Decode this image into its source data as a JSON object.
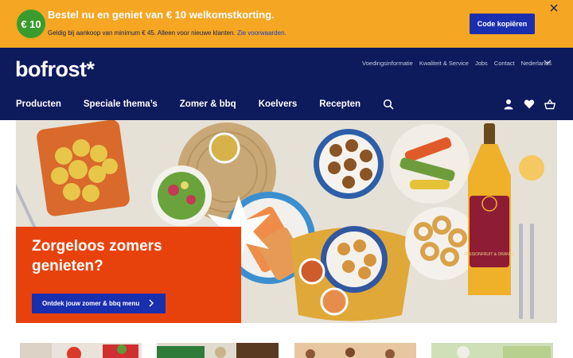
{
  "promo": {
    "badge": "€ 10",
    "title": "Bestel nu en geniet van € 10 welkomstkorting.",
    "subtitle": "Geldig bij aankoop van minimum € 45. Alleen voor nieuwe klanten.",
    "link": "Zie voorwaarden.",
    "button": "Code kopiëren"
  },
  "header": {
    "logo": "bofrost*",
    "topnav": [
      "Voedingsinformatie",
      "Kwaliteit & Service",
      "Jobs",
      "Contact",
      "Nederlands"
    ],
    "mainnav": [
      "Producten",
      "Speciale thema’s",
      "Zomer & bbq",
      "Koelvers",
      "Recepten"
    ]
  },
  "hero": {
    "title": "Zorgeloos zomers genieten?",
    "button": "Ontdek jouw zomer & bbq menu",
    "bottle_label": "PASSIONFRUIT & ORANGE"
  },
  "colors": {
    "promo_bg": "#f5a623",
    "navy": "#0d1a5c",
    "accent_blue": "#1a2fae",
    "hero_orange": "#e8420c",
    "badge_green": "#3a9b2e"
  }
}
